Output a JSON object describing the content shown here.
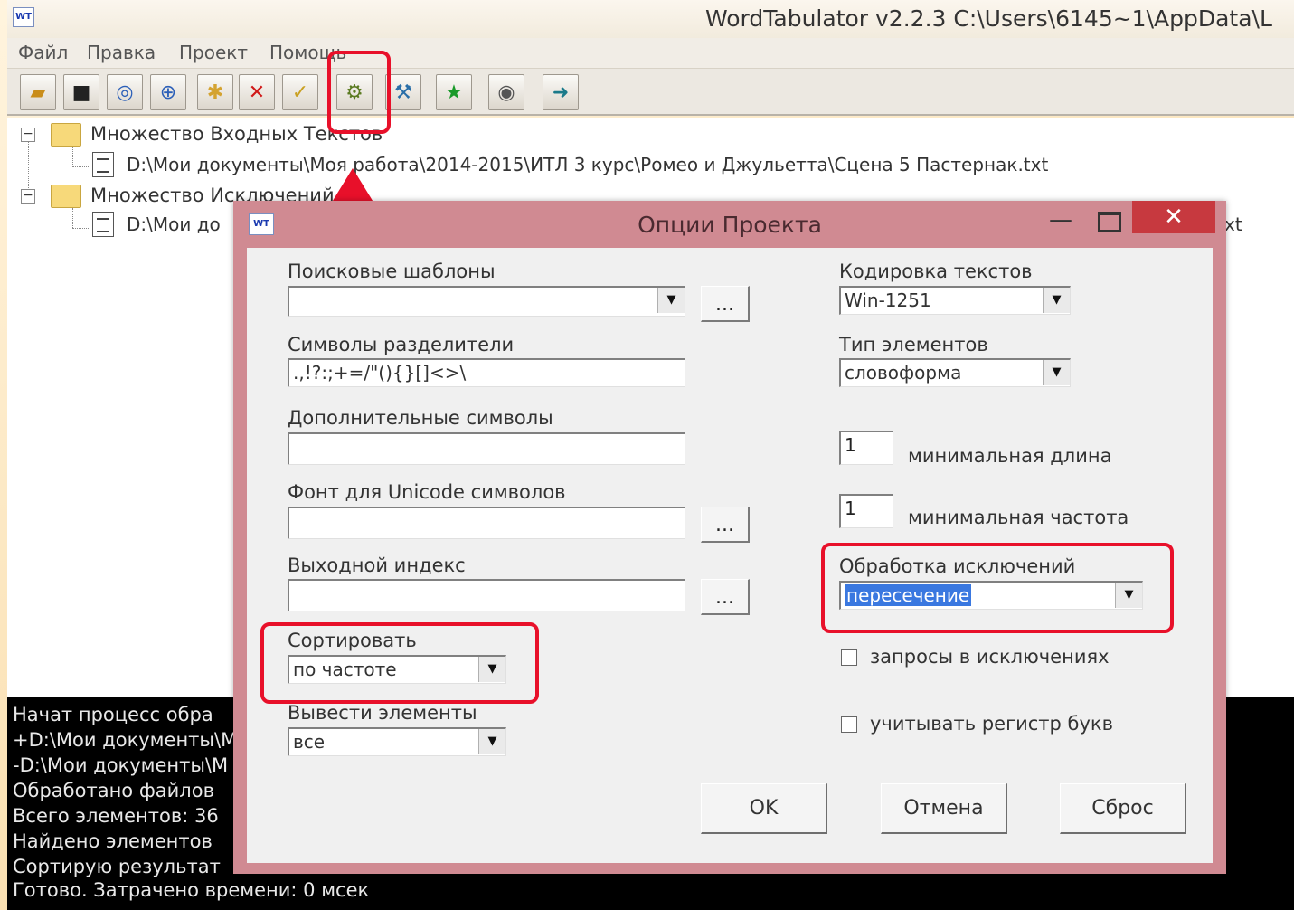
{
  "app": {
    "title": "WordTabulator v2.2.3 C:\\Users\\6145~1\\AppData\\L",
    "icon_text": "WT",
    "menu": [
      "Файл",
      "Правка",
      "Проект",
      "Помощь"
    ],
    "toolbar_icons": [
      "open-folder-icon",
      "save-icon",
      "find-icon",
      "find-replace-icon",
      "new-set-icon",
      "delete-icon",
      "clear-icon",
      "project-options-icon",
      "tools-icon",
      "run-icon",
      "view-icon",
      "exit-icon"
    ]
  },
  "tree": {
    "input_set": "Множество Входных Текстов",
    "input_file": "D:\\Мои документы\\Моя работа\\2014-2015\\ИТЛ 3 курс\\Ромео и Джульетта\\Сцена 5 Пастернак.txt",
    "exclusion_set": "Множество Исключений",
    "exclusion_file": "D:\\Мои до",
    "exclusion_file_tail": "xt"
  },
  "log": [
    "Начат процесс обра",
    "+D:\\Мои документы\\М",
    "-D:\\Мои документы\\М",
    "Обработано файлов",
    "Всего элементов: 36",
    "Найдено элементов",
    "Сортирую результат",
    "Готово. Затрачено времени: 0 мсек"
  ],
  "dialog": {
    "title": "Опции Проекта",
    "icon_text": "WT",
    "close_glyph": "✕",
    "min_glyph": "—",
    "search_templates_label": "Поисковые шаблоны",
    "search_templates_value": "",
    "separators_label": "Символы разделители",
    "separators_value": ".,!?:;+=/\"(){}[]<>\\",
    "extra_symbols_label": "Дополнительные символы",
    "extra_symbols_value": "",
    "unicode_font_label": "Фонт для Unicode символов",
    "unicode_font_value": "",
    "output_index_label": "Выходной индекс",
    "output_index_value": "",
    "sort_label": "Сортировать",
    "sort_value": "по частоте",
    "output_elements_label": "Вывести элементы",
    "output_elements_value": "все",
    "encoding_label": "Кодировка текстов",
    "encoding_value": "Win-1251",
    "element_type_label": "Тип элементов",
    "element_type_value": "словоформа",
    "min_length_value": "1",
    "min_length_label": "минимальная длина",
    "min_freq_value": "1",
    "min_freq_label": "минимальная частота",
    "exclusion_processing_label": "Обработка исключений",
    "exclusion_processing_value": "пересечение",
    "queries_in_exclusions_label": "запросы в исключениях",
    "case_sensitive_label": "учитывать регистр букв",
    "browse_label": "...",
    "ok_label": "OK",
    "cancel_label": "Отмена",
    "reset_label": "Сброс",
    "arrow_glyph": "▼"
  },
  "annotation_color": "#e8102a"
}
